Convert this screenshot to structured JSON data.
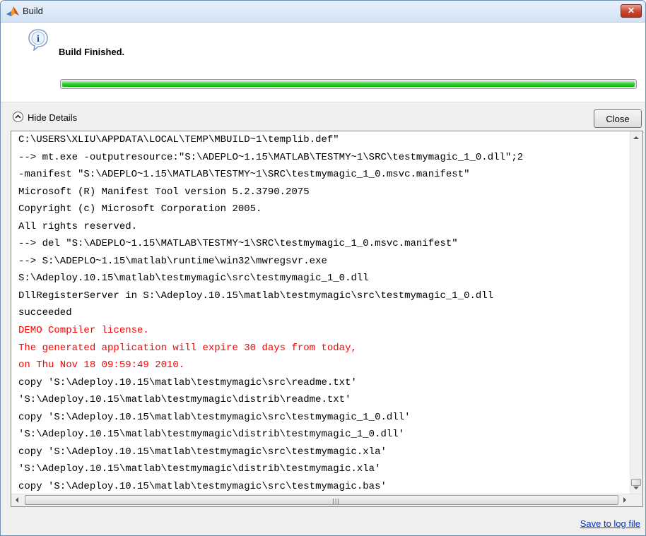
{
  "window": {
    "title": "Build",
    "title_icon": "matlab-logo-icon",
    "close_icon": "close-icon",
    "close_glyph": "✕"
  },
  "header": {
    "message": "Build Finished.",
    "icon": "info-icon",
    "progress_fraction": 1.0,
    "progress_color": "#22c51f"
  },
  "details": {
    "toggle_label": "Hide Details",
    "toggle_icon": "chevron-up-icon",
    "close_label": "Close"
  },
  "log": {
    "lines": [
      {
        "text": "C:\\USERS\\XLIU\\APPDATA\\LOCAL\\TEMP\\MBUILD~1\\templib.def\"",
        "color": "black"
      },
      {
        "text": "--> mt.exe -outputresource:\"S:\\ADEPLO~1.15\\MATLAB\\TESTMY~1\\SRC\\testmymagic_1_0.dll\";2",
        "color": "black"
      },
      {
        "text": "-manifest \"S:\\ADEPLO~1.15\\MATLAB\\TESTMY~1\\SRC\\testmymagic_1_0.msvc.manifest\"",
        "color": "black"
      },
      {
        "text": "Microsoft (R) Manifest Tool version 5.2.3790.2075",
        "color": "black"
      },
      {
        "text": "Copyright (c) Microsoft Corporation 2005.",
        "color": "black"
      },
      {
        "text": "All rights reserved.",
        "color": "black"
      },
      {
        "text": "--> del \"S:\\ADEPLO~1.15\\MATLAB\\TESTMY~1\\SRC\\testmymagic_1_0.msvc.manifest\"",
        "color": "black"
      },
      {
        "text": "--> S:\\ADEPLO~1.15\\matlab\\runtime\\win32\\mwregsvr.exe",
        "color": "black"
      },
      {
        "text": "S:\\Adeploy.10.15\\matlab\\testmymagic\\src\\testmymagic_1_0.dll",
        "color": "black"
      },
      {
        "text": "DllRegisterServer in S:\\Adeploy.10.15\\matlab\\testmymagic\\src\\testmymagic_1_0.dll",
        "color": "black"
      },
      {
        "text": "succeeded",
        "color": "black"
      },
      {
        "text": "DEMO Compiler license.",
        "color": "red"
      },
      {
        "text": "The generated application will expire 30 days from today,",
        "color": "red"
      },
      {
        "text": "on Thu Nov 18 09:59:49 2010.",
        "color": "red"
      },
      {
        "text": "copy 'S:\\Adeploy.10.15\\matlab\\testmymagic\\src\\readme.txt'",
        "color": "black"
      },
      {
        "text": "'S:\\Adeploy.10.15\\matlab\\testmymagic\\distrib\\readme.txt'",
        "color": "black"
      },
      {
        "text": "copy 'S:\\Adeploy.10.15\\matlab\\testmymagic\\src\\testmymagic_1_0.dll'",
        "color": "black"
      },
      {
        "text": "'S:\\Adeploy.10.15\\matlab\\testmymagic\\distrib\\testmymagic_1_0.dll'",
        "color": "black"
      },
      {
        "text": "copy 'S:\\Adeploy.10.15\\matlab\\testmymagic\\src\\testmymagic.xla'",
        "color": "black"
      },
      {
        "text": "'S:\\Adeploy.10.15\\matlab\\testmymagic\\distrib\\testmymagic.xla'",
        "color": "black"
      },
      {
        "text": "copy 'S:\\Adeploy.10.15\\matlab\\testmymagic\\src\\testmymagic.bas'",
        "color": "black"
      }
    ],
    "error_color": "#ff0000"
  },
  "footer": {
    "save_link": "Save to log file"
  }
}
